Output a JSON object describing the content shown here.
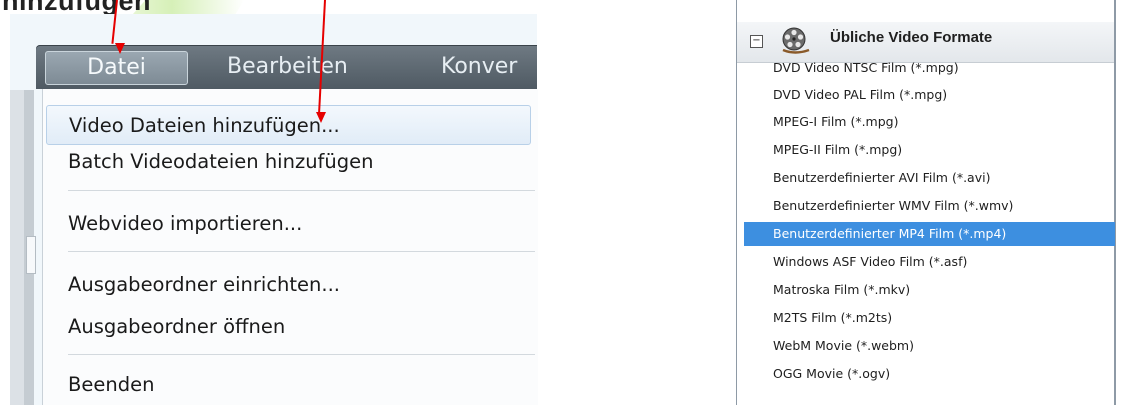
{
  "heading": "hinzufügen",
  "menubar": {
    "items": [
      "Datei",
      "Bearbeiten",
      "Konver"
    ]
  },
  "file_menu": {
    "items": [
      "Video Dateien hinzufügen...",
      "Batch Videodateien hinzufügen",
      "Webvideo importieren...",
      "Ausgabeordner einrichten...",
      "Ausgabeordner öffnen",
      "Beenden"
    ],
    "highlighted_index": 0
  },
  "format_panel": {
    "collapse_symbol": "−",
    "title": "Übliche Video Formate",
    "formats": [
      "DVD Video NTSC Film (*.mpg)",
      "DVD Video PAL Film (*.mpg)",
      "MPEG-I Film (*.mpg)",
      "MPEG-II Film (*.mpg)",
      "Benutzerdefinierter AVI Film (*.avi)",
      "Benutzerdefinierter WMV Film (*.wmv)",
      "Benutzerdefinierter MP4 Film (*.mp4)",
      "Windows ASF Video Film (*.asf)",
      "Matroska Film (*.mkv)",
      "M2TS Film (*.m2ts)",
      "WebM Movie (*.webm)",
      "OGG Movie (*.ogv)"
    ],
    "selected_index": 6
  },
  "colors": {
    "selection": "#3d8fe0",
    "arrow": "#e60000",
    "menubar": "#5f6a73"
  }
}
